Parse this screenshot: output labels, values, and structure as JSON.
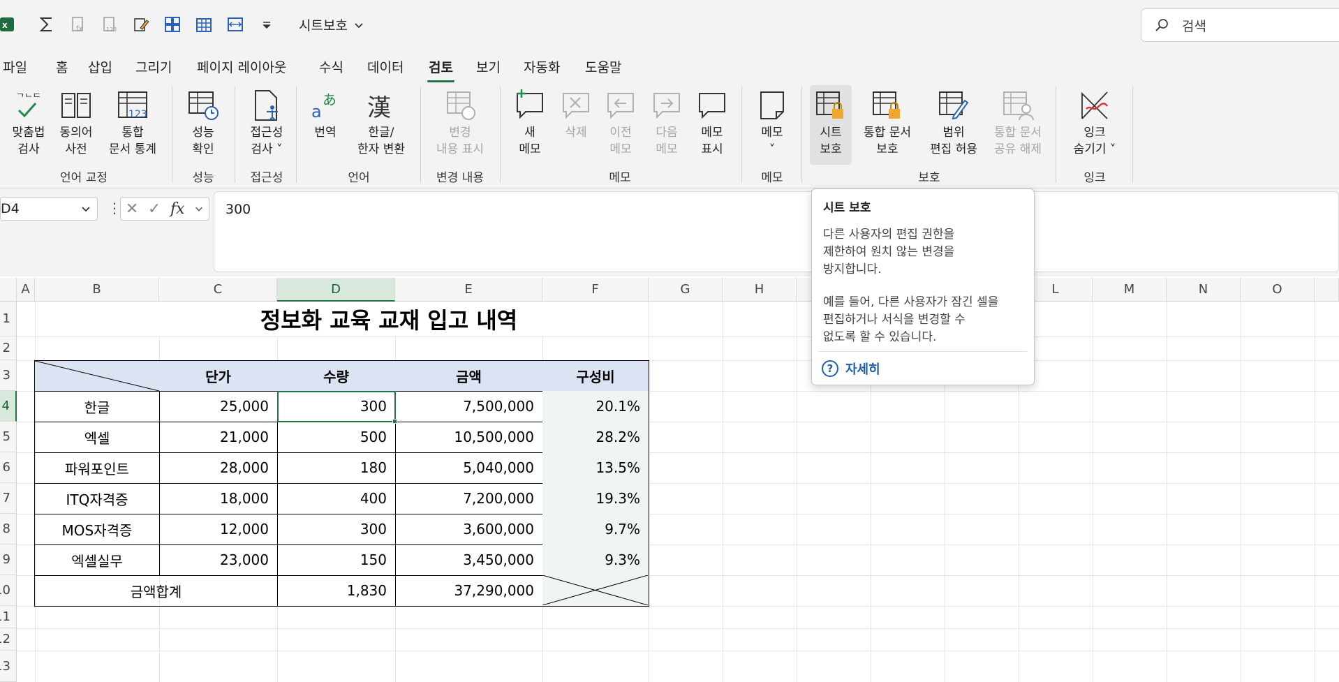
{
  "titlebar": {
    "workbook_title": "시트보호",
    "search_placeholder": "검색"
  },
  "tabs": [
    "파일",
    "홈",
    "삽입",
    "그리기",
    "페이지 레이아웃",
    "수식",
    "데이터",
    "검토",
    "보기",
    "자동화",
    "도움말"
  ],
  "active_tab": "검토",
  "ribbon": {
    "spelling": "맞춤법\n검사",
    "thesaurus": "동의어\n사전",
    "workbook_stats": "통합\n문서 통계",
    "check_performance": "성능\n확인",
    "check_accessibility": "접근성\n검사 ˅",
    "translate": "번역",
    "hangul_hanja": "한글/\n한자 변환",
    "show_changes": "변경\n내용 표시",
    "new_note": "새\n메모",
    "delete": "삭제",
    "previous": "이전\n메모",
    "next": "다음\n메모",
    "show_notes": "메모\n표시",
    "notes": "메모\n˅",
    "protect_sheet": "시트\n보호",
    "protect_workbook": "통합 문서\n보호",
    "allow_edit_ranges": "범위\n편집 허용",
    "unshare_workbook": "통합 문서\n공유 해제",
    "hide_ink": "잉크\n숨기기 ˅",
    "groups": {
      "proofing": "언어 교정",
      "performance": "성능",
      "accessibility": "접근성",
      "language": "언어",
      "changes": "변경 내용",
      "comments": "메모",
      "notes": "메모",
      "protect": "보호",
      "ink": "잉크"
    }
  },
  "formula_bar": {
    "name_box": "D4",
    "formula": "300"
  },
  "columns": [
    "A",
    "B",
    "C",
    "D",
    "E",
    "F",
    "G",
    "H",
    "L",
    "M",
    "N",
    "O"
  ],
  "rows": [
    "1",
    "2",
    "3",
    "4",
    "5",
    "6",
    "7",
    "8",
    "9",
    "10",
    "11",
    "12",
    "13"
  ],
  "sheet": {
    "title": "정보화 교육 교재 입고 내역",
    "headers": [
      "단가",
      "수량",
      "금액",
      "구성비"
    ],
    "data": [
      [
        "한글",
        "25,000",
        "300",
        "7,500,000",
        "20.1%"
      ],
      [
        "엑셀",
        "21,000",
        "500",
        "10,500,000",
        "28.2%"
      ],
      [
        "파워포인트",
        "28,000",
        "180",
        "5,040,000",
        "13.5%"
      ],
      [
        "ITQ자격증",
        "18,000",
        "400",
        "7,200,000",
        "19.3%"
      ],
      [
        "MOS자격증",
        "12,000",
        "300",
        "3,600,000",
        "9.7%"
      ],
      [
        "엑셀실무",
        "23,000",
        "150",
        "3,450,000",
        "9.3%"
      ]
    ],
    "total_label": "금액합계",
    "total_qty": "1,830",
    "total_amount": "37,290,000"
  },
  "tooltip": {
    "title": "시트 보호",
    "p1": "다른 사용자의 편집 권한을\n제한하여 원치 않는 변경을\n방지합니다.",
    "p2": "예를 들어, 다른 사용자가 잠긴 셀을\n편집하거나 서식을 변경할 수\n없도록 할 수 있습니다.",
    "more": "자세히"
  },
  "colors": {
    "accent": "#217346",
    "header_fill": "#dce3f2",
    "pct_fill": "#eef5f4",
    "link": "#1f5fa8"
  }
}
